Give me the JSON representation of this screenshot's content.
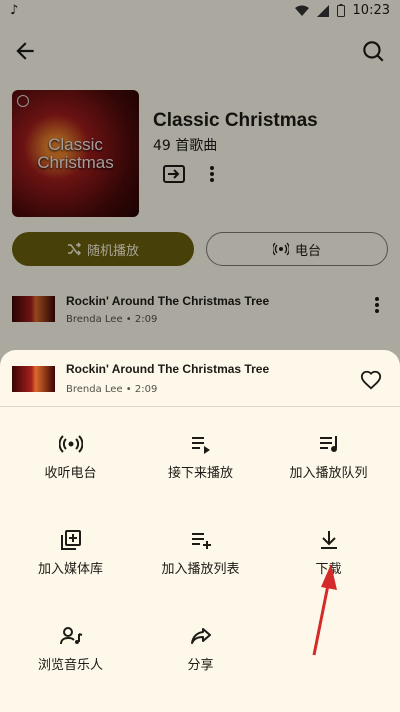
{
  "status_bar": {
    "time": "10:23"
  },
  "album": {
    "art_text_line1": "Classic",
    "art_text_line2": "Christmas",
    "title": "Classic Christmas",
    "subtitle": "49 首歌曲"
  },
  "buttons": {
    "shuffle": "随机播放",
    "radio": "电台"
  },
  "tracks": [
    {
      "title": "Rockin' Around The Christmas Tree",
      "subtitle": "Brenda Lee • 2:09"
    }
  ],
  "sheet": {
    "track": {
      "title": "Rockin' Around The Christmas Tree",
      "subtitle": "Brenda Lee • 2:09"
    },
    "actions": [
      {
        "label": "收听电台",
        "icon": "radio-icon"
      },
      {
        "label": "接下来播放",
        "icon": "play-next-icon"
      },
      {
        "label": "加入播放队列",
        "icon": "add-to-queue-icon"
      },
      {
        "label": "加入媒体库",
        "icon": "add-to-library-icon"
      },
      {
        "label": "加入播放列表",
        "icon": "add-to-playlist-icon"
      },
      {
        "label": "下载",
        "icon": "download-icon"
      },
      {
        "label": "浏览音乐人",
        "icon": "artist-icon"
      },
      {
        "label": "分享",
        "icon": "share-icon"
      }
    ]
  },
  "colors": {
    "accent": "#6b5f0e",
    "background": "#fdf8ea",
    "annotation_arrow": "#d42a2a"
  }
}
